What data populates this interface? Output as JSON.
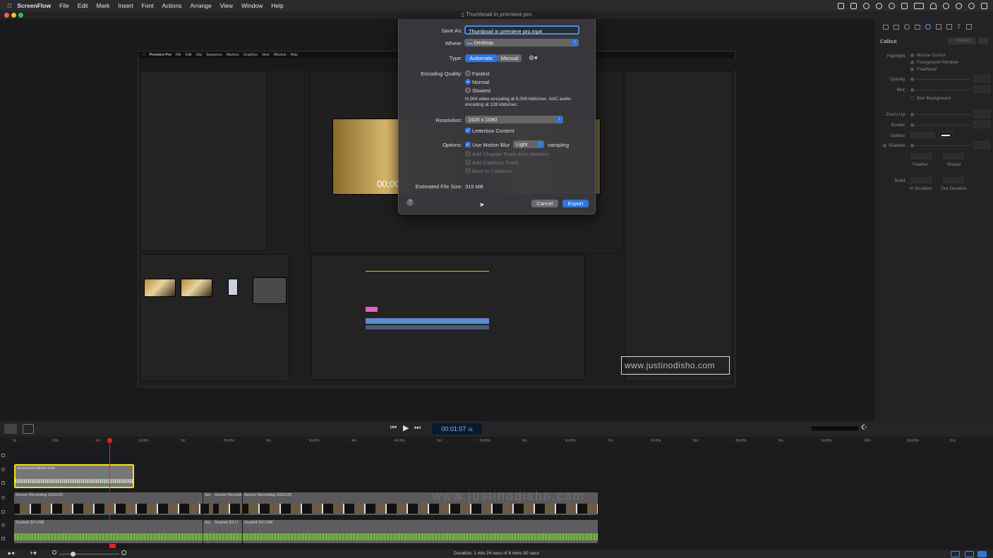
{
  "menubar": {
    "app_name": "ScreenFlow",
    "items": [
      "File",
      "Edit",
      "Mark",
      "Insert",
      "Font",
      "Actions",
      "Arrange",
      "View",
      "Window",
      "Help"
    ]
  },
  "window": {
    "title": "Thumbnail in premiere pro"
  },
  "premiere": {
    "menu": [
      "Premiere Pro",
      "File",
      "Edit",
      "Clip",
      "Sequence",
      "Markers",
      "Graphics",
      "View",
      "Window",
      "Help"
    ],
    "timecode": "00;00",
    "watermark": "www.justinodisho.com"
  },
  "dialog": {
    "save_as_label": "Save As:",
    "save_as_value": "Thumbnail in premiere pro.mp4",
    "where_label": "Where:",
    "where_value": "Desktop",
    "type_label": "Type:",
    "type_automatic": "Automatic",
    "type_manual": "Manual",
    "quality_label": "Encoding Quality:",
    "quality_fastest": "Fastest",
    "quality_normal": "Normal",
    "quality_slowest": "Slowest",
    "encoding_info_1": "H.264 video encoding at 6,000 kbits/sec.  AAC audio",
    "encoding_info_2": "encoding at 128 kbits/sec.",
    "resolution_label": "Resolution:",
    "resolution_value": "1920 x 1080",
    "letterbox": "Letterbox Content",
    "options_label": "Options:",
    "motion_blur": "Use Motion Blur",
    "motion_blur_level": "Light",
    "sampling": "sampling",
    "add_chapter": "Add Chapter Track from Markers",
    "add_captions": "Add Captions Track",
    "burn_captions": "Burn In Captions",
    "file_size_label": "Estimated File Size:",
    "file_size_value": "315 MB",
    "help": "?",
    "cancel": "Cancel",
    "export": "Export"
  },
  "inspector": {
    "title": "Callout",
    "action_button": "+ Action",
    "highlight_label": "Highlight:",
    "highlight_options": [
      "Mouse Cursor",
      "Foreground Window",
      "Freehand"
    ],
    "opacity_label": "Opacity:",
    "blur_label": "Blur:",
    "blur_background": "Blur Background",
    "zoom_up_label": "Zoom Up:",
    "border_label": "Border:",
    "outline_label": "Outline:",
    "shadow_label": "Shadow:",
    "feather_label": "Feather",
    "round_label": "Round",
    "build_label": "Build:",
    "in_duration": "In Duration",
    "out_duration": "Out Duration"
  },
  "transport": {
    "timecode": "00:01:07",
    "frames": "16"
  },
  "ruler": {
    "ticks": [
      "0s",
      "30s",
      "1m",
      "1m30s",
      "2m",
      "2m30s",
      "3m",
      "3m30s",
      "4m",
      "4m30s",
      "5m",
      "5m30s",
      "6m",
      "6m30s",
      "7m",
      "7m30s",
      "8m",
      "8m30s",
      "9m",
      "9m30s",
      "10m",
      "10m30s",
      "11m"
    ]
  },
  "tracks": {
    "callout_clip": "www.justinodisho.com",
    "screen_clip_1": "Screen Recording 10/31/20",
    "screen_clip_2": "Scr",
    "screen_clip_3": "Screen Recordi",
    "screen_clip_4": "Screen Recording 10/31/20",
    "audio_clip_1": "Scarlett 2i2 USB",
    "audio_clip_2": "Scr",
    "audio_clip_3": "Scarlett 2i2 U",
    "audio_clip_4": "Scarlett 2i2 USB",
    "watermark": "www.justinodisho.com"
  },
  "status": {
    "duration": "Duration: 1 min 24 secs of 6 mins 50 secs"
  },
  "colors": {
    "accent": "#2f74e0",
    "selection": "#f2e01c",
    "playhead": "#e02424",
    "audio_wave": "#7fcf4a"
  }
}
